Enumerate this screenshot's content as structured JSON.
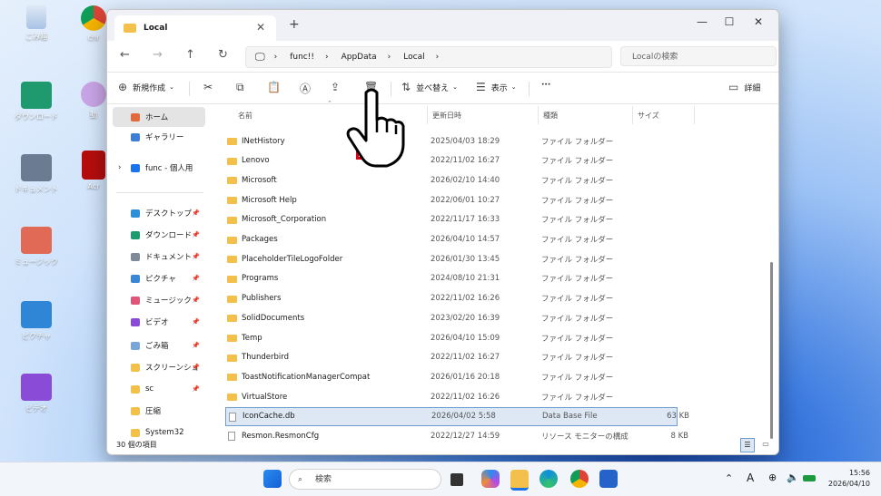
{
  "desktop": {
    "icons": [
      {
        "label": "ごみ箱"
      },
      {
        "label": "chr"
      },
      {
        "label": "ダウンロード"
      },
      {
        "label": "動"
      },
      {
        "label": "ドキュメント"
      },
      {
        "label": "Acr"
      },
      {
        "label": "ミュージック"
      },
      {
        "label": "ピクチャ"
      },
      {
        "label": "ビデオ"
      }
    ]
  },
  "window": {
    "tab_title": "Local",
    "breadcrumb": [
      "func!!",
      "AppData",
      "Local"
    ],
    "search_placeholder": "Localの検索",
    "toolbar": {
      "new_label": "新規作成",
      "sort_label": "並べ替え",
      "view_label": "表示",
      "more_label": "···",
      "details_label": "詳細"
    },
    "sidebar": [
      {
        "label": "ホーム",
        "color": "#e06a3c"
      },
      {
        "label": "ギャラリー",
        "color": "#3b7fd6"
      },
      {
        "label": "func - 個人用",
        "color": "#1a73e8"
      },
      {
        "label": "デスクトップ",
        "color": "#2f8fd8"
      },
      {
        "label": "ダウンロード",
        "color": "#1e9a6e"
      },
      {
        "label": "ドキュメント",
        "color": "#7f8a99"
      },
      {
        "label": "ピクチャ",
        "color": "#3a86d6"
      },
      {
        "label": "ミュージック",
        "color": "#e0567a"
      },
      {
        "label": "ビデオ",
        "color": "#8a4bd6"
      },
      {
        "label": "ごみ箱",
        "color": "#7aa6d8"
      },
      {
        "label": "スクリーンショ",
        "color": "#f3c14b"
      },
      {
        "label": "sc",
        "color": "#f3c14b"
      },
      {
        "label": "圧縮",
        "color": "#f3c14b"
      },
      {
        "label": "System32",
        "color": "#f3c14b"
      }
    ],
    "columns": {
      "name": "名前",
      "date": "更新日時",
      "type": "種類",
      "size": "サイズ"
    },
    "files": [
      {
        "name": "INetHistory",
        "date": "2025/04/03 18:29",
        "type": "ファイル フォルダー",
        "size": "",
        "kind": "folder"
      },
      {
        "name": "Lenovo",
        "date": "2022/11/02 16:27",
        "type": "ファイル フォルダー",
        "size": "",
        "kind": "folder"
      },
      {
        "name": "Microsoft",
        "date": "2026/02/10 14:40",
        "type": "ファイル フォルダー",
        "size": "",
        "kind": "folder"
      },
      {
        "name": "Microsoft Help",
        "date": "2022/06/01 10:27",
        "type": "ファイル フォルダー",
        "size": "",
        "kind": "folder"
      },
      {
        "name": "Microsoft_Corporation",
        "date": "2022/11/17 16:33",
        "type": "ファイル フォルダー",
        "size": "",
        "kind": "folder"
      },
      {
        "name": "Packages",
        "date": "2026/04/10 14:57",
        "type": "ファイル フォルダー",
        "size": "",
        "kind": "folder"
      },
      {
        "name": "PlaceholderTileLogoFolder",
        "date": "2026/01/30 13:45",
        "type": "ファイル フォルダー",
        "size": "",
        "kind": "folder"
      },
      {
        "name": "Programs",
        "date": "2024/08/10 21:31",
        "type": "ファイル フォルダー",
        "size": "",
        "kind": "folder"
      },
      {
        "name": "Publishers",
        "date": "2022/11/02 16:26",
        "type": "ファイル フォルダー",
        "size": "",
        "kind": "folder"
      },
      {
        "name": "SolidDocuments",
        "date": "2023/02/20 16:39",
        "type": "ファイル フォルダー",
        "size": "",
        "kind": "folder"
      },
      {
        "name": "Temp",
        "date": "2026/04/10 15:09",
        "type": "ファイル フォルダー",
        "size": "",
        "kind": "folder"
      },
      {
        "name": "Thunderbird",
        "date": "2022/11/02 16:27",
        "type": "ファイル フォルダー",
        "size": "",
        "kind": "folder"
      },
      {
        "name": "ToastNotificationManagerCompat",
        "date": "2026/01/16 20:18",
        "type": "ファイル フォルダー",
        "size": "",
        "kind": "folder"
      },
      {
        "name": "VirtualStore",
        "date": "2022/11/02 16:26",
        "type": "ファイル フォルダー",
        "size": "",
        "kind": "folder"
      },
      {
        "name": "IconCache.db",
        "date": "2026/04/02 5:58",
        "type": "Data Base File",
        "size": "63 KB",
        "kind": "file",
        "selected": true
      },
      {
        "name": "Resmon.ResmonCfg",
        "date": "2022/12/27 14:59",
        "type": "リソース モニターの構成",
        "size": "8 KB",
        "kind": "file"
      }
    ],
    "status_count": "30 個の項目"
  },
  "taskbar": {
    "search_label": "検索",
    "time": "15:56",
    "date": "2026/04/10",
    "ime": "A"
  }
}
